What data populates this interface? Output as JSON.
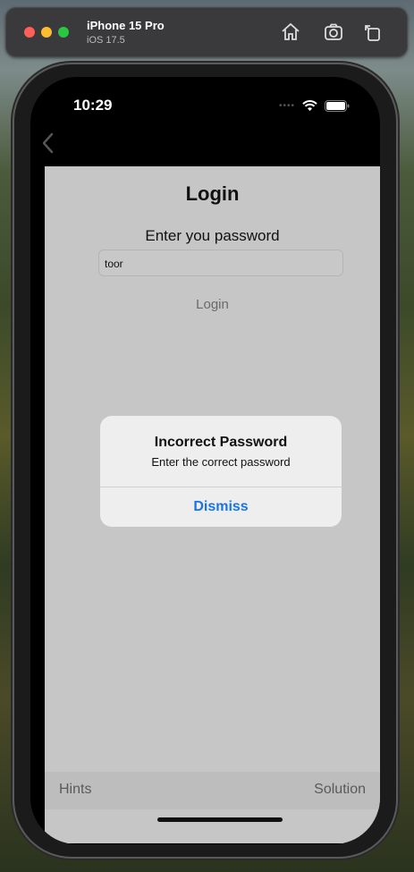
{
  "simulator": {
    "device_name": "iPhone 15 Pro",
    "os_version": "iOS 17.5",
    "icons": [
      "home-icon",
      "screenshot-icon",
      "rotate-icon"
    ]
  },
  "status_bar": {
    "time": "10:29",
    "icons": [
      "signal-icon",
      "wifi-icon",
      "battery-icon"
    ]
  },
  "nav": {
    "back_icon": "chevron-left-icon"
  },
  "login": {
    "title": "Login",
    "prompt": "Enter you password",
    "password_value": "toor",
    "login_button": "Login"
  },
  "alert": {
    "title": "Incorrect Password",
    "message": "Enter the correct password",
    "dismiss_button": "Dismiss"
  },
  "bottom_bar": {
    "hints": "Hints",
    "solution": "Solution"
  },
  "colors": {
    "accent": "#1a73e8",
    "screen_bg": "#c6c6c6",
    "alert_bg": "#eeeeee"
  }
}
